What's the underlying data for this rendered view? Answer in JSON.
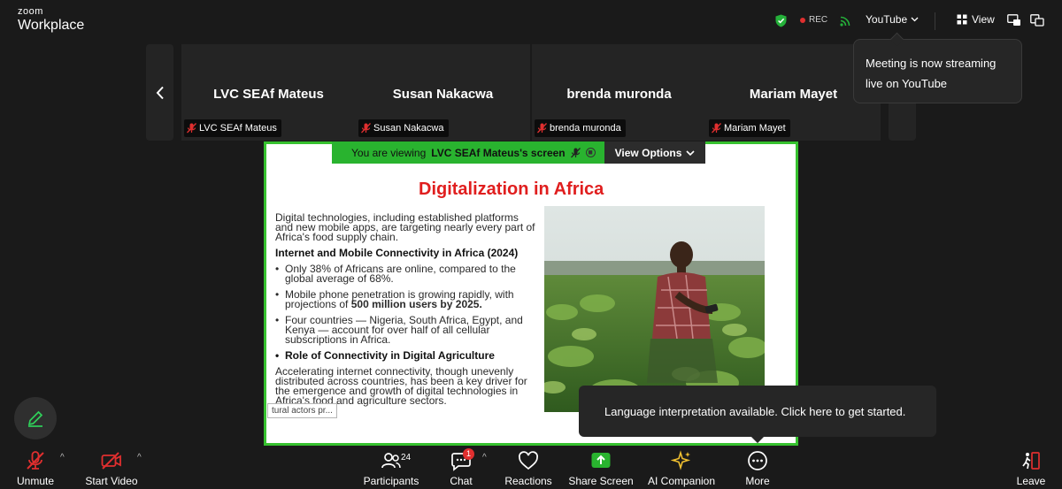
{
  "app": {
    "brand_top": "zoom",
    "brand_bottom": "Workplace"
  },
  "topbar": {
    "rec_label": "REC",
    "stream_target": "YouTube",
    "view_label": "View"
  },
  "stream_tooltip": {
    "text": "Meeting is now streaming live on YouTube"
  },
  "participants_strip": [
    {
      "name": "LVC SEAf Mateus",
      "label": "LVC SEAf Mateus",
      "muted": true
    },
    {
      "name": "Susan Nakacwa",
      "label": "Susan Nakacwa",
      "muted": true
    },
    {
      "name": "brenda muronda",
      "label": "brenda muronda",
      "muted": true
    },
    {
      "name": "Mariam Mayet",
      "label": "Mariam Mayet",
      "muted": true
    }
  ],
  "share": {
    "viewing_prefix": "You are viewing",
    "viewing_name": "LVC SEAf Mateus's screen",
    "view_options": "View Options",
    "frame_color": "#36c12f"
  },
  "slide": {
    "title": "Digitalization in Africa",
    "intro": "Digital technologies, including established platforms and new mobile apps, are targeting nearly every part of Africa's food supply chain.",
    "heading": "Internet and Mobile Connectivity in Africa (2024)",
    "bullets": [
      "Only 38% of Africans are online, compared to the global average of 68%.",
      "Mobile phone penetration is growing rapidly, with projections of ",
      "Four countries — Nigeria, South Africa, Egypt, and Kenya — account for over half of all cellular subscriptions in Africa."
    ],
    "bullet2_bold": "500 million users by 2025.",
    "bullet_role": "Role of Connectivity in Digital Agriculture",
    "closing": "Accelerating internet connectivity, though unevenly distributed across countries, has been a key driver for the emergence and growth of digital technologies in Africa's food and agriculture sectors.",
    "caption_chip": "tural actors pr..."
  },
  "lang_tooltip": {
    "text": "Language interpretation available. Click here to get started."
  },
  "toolbar": {
    "unmute": "Unmute",
    "start_video": "Start Video",
    "participants": "Participants",
    "participants_count": "24",
    "chat": "Chat",
    "chat_badge": "1",
    "reactions": "Reactions",
    "share_screen": "Share Screen",
    "ai_companion": "AI Companion",
    "more": "More",
    "leave": "Leave"
  },
  "colors": {
    "share_green": "#29b32f",
    "danger_red": "#e02f2f",
    "title_red": "#e01e1e"
  }
}
